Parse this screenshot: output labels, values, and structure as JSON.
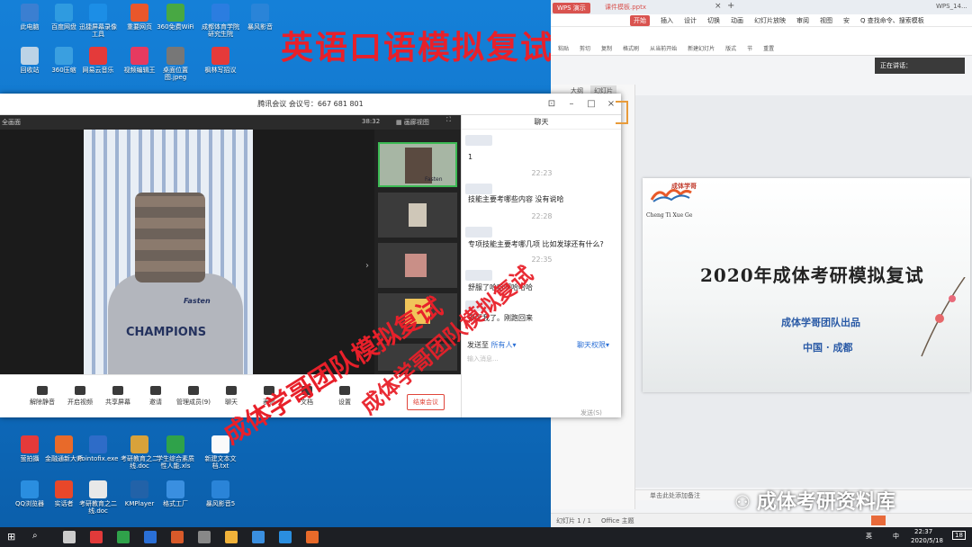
{
  "overlay": {
    "title": "英语口语模拟复试",
    "watermark1": "成体学哥团队模拟复试",
    "watermark2": "成体学哥团队模拟复试",
    "wechat": "成体考研资料库"
  },
  "desktop": {
    "icons": [
      "此电脑",
      "百度网盘",
      "迅捷屏幕录像工具",
      "重要网页",
      "360免费WiFi",
      "成都体育学院研究生院",
      "暴风影音",
      "回收站",
      "360压缩",
      "网易云音乐",
      "视频编辑王",
      "桌面位置图.jpeg",
      "枫林写招议",
      "萤拍攝",
      "金融通新大师",
      "Pointofix.exe",
      "考研教育之二线.doc",
      "学生综合素质性人能.xls",
      "新建文本文档.txt",
      "QQ浏览器",
      "实话者",
      "考研教育之二线.doc",
      "KMPlayer",
      "格式工厂",
      "暴风影音5"
    ]
  },
  "meeting": {
    "title": "腾讯会议 会议号：667 681 801",
    "time": "38:32",
    "view": "画廊视图",
    "left_label": "全画面",
    "shirt1": "Fasten",
    "shirt2": "CHAMPIONS",
    "thumb1": "Fasten",
    "controls": [
      "解除静音",
      "开启视频",
      "共享屏幕",
      "邀请",
      "管理成员(9)",
      "聊天",
      "表情",
      "文档",
      "设置"
    ],
    "end": "结束会议",
    "chat": {
      "header": "聊天",
      "messages": [
        {
          "t": "",
          "text": "1"
        },
        {
          "t": "22:23",
          "text": "技能主要考哪些内容 没有说哈"
        },
        {
          "t": "22:28",
          "text": "专项技能主要考哪几项  比如发球还有什么?"
        },
        {
          "t": "22:35",
          "text": "舒服了哈哈啊哈哈哈"
        },
        {
          "t": "",
          "text": "累死我了。刚跑回来"
        }
      ],
      "send_to": "发送至",
      "to": "所有人",
      "perm": "聊天权限",
      "input": "输入消息...",
      "send": "发送(S)"
    }
  },
  "wps": {
    "tab1": "WPS 演示",
    "tab2": "课件模板.pptx",
    "top": "WPS_14...",
    "menus": [
      "开始",
      "插入",
      "设计",
      "切换",
      "动画",
      "幻灯片放映",
      "审阅",
      "视图",
      "安",
      "Q 查找命令、搜索模板"
    ],
    "toolbar": [
      "粘贴",
      "剪切",
      "复制",
      "格式刷",
      "从当前开始",
      "新建幻灯片",
      "版式",
      "节",
      "重置"
    ],
    "sidebar": [
      "大纲",
      "幻灯片"
    ],
    "speaking": "正在讲话：",
    "slide": {
      "logo": "成体学哥",
      "logo2": "Cheng Ti Xue Ge",
      "title": "2020年成体考研模拟复试",
      "sub1": "成体学哥团队出品",
      "sub2": "中国 · 成都"
    },
    "notes": "单击此处添加备注",
    "status1": "幻灯片 1 / 1",
    "status2": "Office 主题"
  },
  "taskbar": {
    "time": "22:37",
    "date": "2020/5/18",
    "num": "18",
    "ime": "中",
    "zh": "英"
  }
}
